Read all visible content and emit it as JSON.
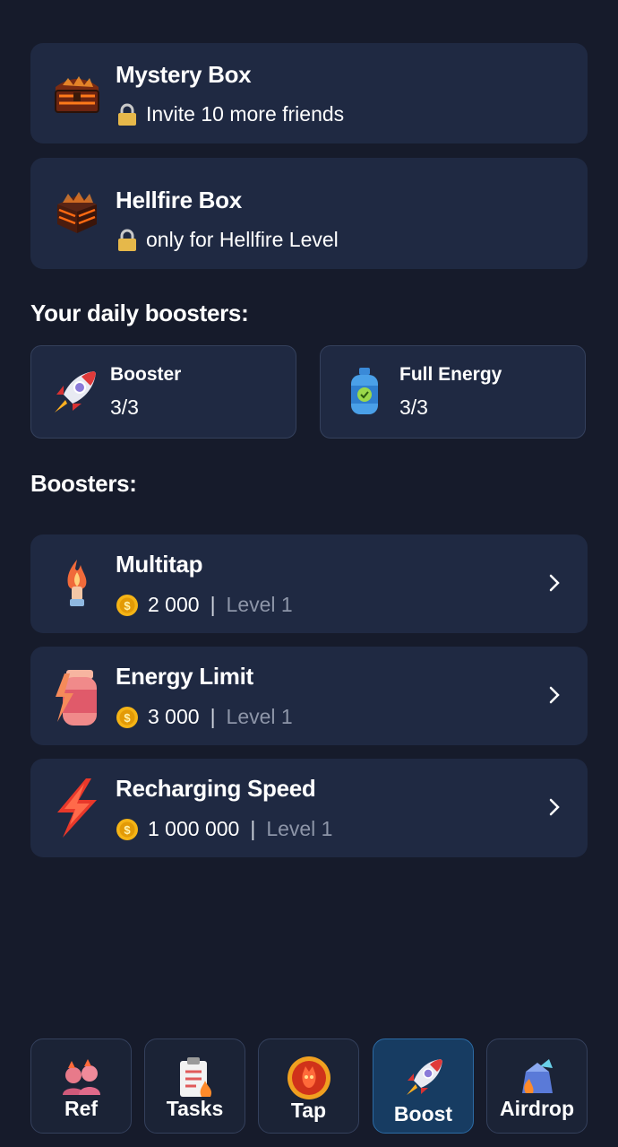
{
  "boxes": [
    {
      "title": "Mystery Box",
      "subtitle": "Invite 10 more friends",
      "icon": "treasure-chest-icon"
    },
    {
      "title": "Hellfire Box",
      "subtitle": "only for Hellfire Level",
      "icon": "hellfire-chest-icon"
    }
  ],
  "daily": {
    "title": "Your daily boosters:",
    "items": [
      {
        "name": "Booster",
        "count": "3/3",
        "icon": "rocket-icon"
      },
      {
        "name": "Full Energy",
        "count": "3/3",
        "icon": "gas-canister-icon"
      }
    ]
  },
  "boosters": {
    "title": "Boosters:",
    "items": [
      {
        "name": "Multitap",
        "price": "2 000",
        "level": "Level 1",
        "icon": "flame-hand-icon"
      },
      {
        "name": "Energy Limit",
        "price": "3 000",
        "level": "Level 1",
        "icon": "battery-bolt-icon"
      },
      {
        "name": "Recharging Speed",
        "price": "1 000 000",
        "level": "Level 1",
        "icon": "lightning-icon"
      }
    ],
    "separator": "|"
  },
  "nav": [
    {
      "label": "Ref",
      "icon": "friends-icon",
      "active": false
    },
    {
      "label": "Tasks",
      "icon": "clipboard-icon",
      "active": false
    },
    {
      "label": "Tap",
      "icon": "tap-coin-icon",
      "active": false
    },
    {
      "label": "Boost",
      "icon": "rocket-icon",
      "active": true
    },
    {
      "label": "Airdrop",
      "icon": "airdrop-icon",
      "active": false
    }
  ],
  "colors": {
    "background": "#161b2b",
    "card": "#1f2942",
    "active_nav": "#173c62",
    "muted": "#8d95a8",
    "coin": "#f5b416"
  }
}
